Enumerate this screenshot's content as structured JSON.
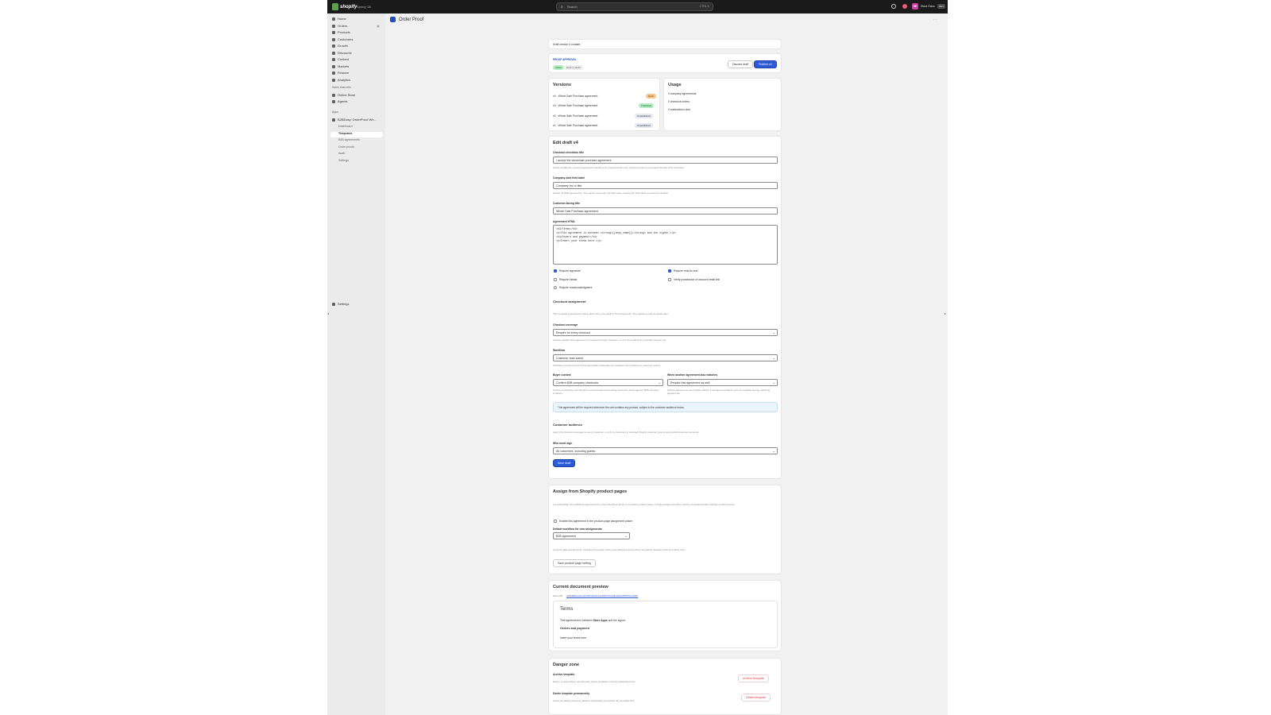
{
  "topbar": {
    "brand": "shopify",
    "store": "Spring '26",
    "search_placeholder": "Search",
    "search_shortcut": "CTRL K",
    "user_initials": "SE",
    "user_name": "Store Extra",
    "user_badge": "DEV"
  },
  "sidebar": {
    "items": [
      {
        "label": "Home"
      },
      {
        "label": "Orders",
        "badge": "3"
      },
      {
        "label": "Products"
      },
      {
        "label": "Customers"
      },
      {
        "label": "Growth"
      },
      {
        "label": "Discounts"
      },
      {
        "label": "Content"
      },
      {
        "label": "Markets"
      },
      {
        "label": "Finance"
      },
      {
        "label": "Analytics"
      }
    ],
    "sales_channels_label": "Sales channels",
    "channels": [
      {
        "label": "Online Store"
      },
      {
        "label": "Agents"
      }
    ],
    "apps_label": "Apps",
    "app_name": "B2BEasy: OrderProof Wh...",
    "app_subitems": [
      "Dashboard",
      "Templates",
      "B2B agreements",
      "Order proofs",
      "Audit",
      "Settings"
    ],
    "settings_label": "Settings"
  },
  "page": {
    "title": "Order Proof"
  },
  "banner": {
    "text": "Draft version 4 created."
  },
  "proof_header": {
    "heading": "PROOF APPROVAL",
    "status_pill": "Active",
    "draft_pill": "Draft 4 (draft)",
    "discard_label": "Discard draft",
    "publish_label": "Publish v4"
  },
  "versions": {
    "title": "Versions",
    "rows": [
      {
        "label": "v4 · Whole Sale Purchase agreement",
        "status": "Draft"
      },
      {
        "label": "v3 · Whole Sale Purchase agreement",
        "status": "Published"
      },
      {
        "label": "v2 · Whole Sale Purchase agreement",
        "status": "Unpublished"
      },
      {
        "label": "v1 · Whole Sale Purchase agreement",
        "status": "Unpublished"
      }
    ],
    "colors": {
      "Draft": "#f5c58a",
      "Published": "#b6ecc6",
      "Unpublished": "#e3e8f3"
    }
  },
  "usage": {
    "title": "Usage",
    "lines": [
      "0 company agreements",
      "0 checkout orders",
      "0 automation rules"
    ]
  },
  "edit": {
    "title": "Edit draft v4",
    "checkout_label": "Checkout checkbox title",
    "checkout_value": "I accept the wholesale purchase agreement",
    "checkout_help": "Shown beside the required agreement checkbox at checkout before the checkout action is accepted (Shopify Plus checkout).",
    "company_label": "Company-side field label",
    "company_value": "Company rep or title",
    "company_help": "Shown for B2B agreements. The signer must enter the field value, leaving the field blank removes the default.",
    "customer_label": "Customer-facing title",
    "customer_value": "Whole Sale Purchase agreement",
    "html_label": "Agreement HTML",
    "html_lines": [
      "<h3>Terms</h3>",
      "<p>This agreement is between <strong>{{shop_name}}</strong> and the signer.</p>",
      "<h4>Orders and payment</h4>",
      "<p>Insert your terms here.</p>"
    ],
    "checks": [
      {
        "label": "Require signature",
        "checked": true
      },
      {
        "label": "Require read-to-end",
        "checked": true
      },
      {
        "label": "Require initials",
        "checked": false
      },
      {
        "label": "Verify possession of account email link",
        "checked": false
      }
    ],
    "radio_label": "Require reacknowledgment",
    "assign_title": "Checkout assignment",
    "assign_help": "This template's assignment takes effect when you publish \"Proof Approval\". Also applies products added later.",
    "coverage_label": "Checkout coverage",
    "coverage_value": "Require for every checkout",
    "coverage_help": "Choose whether this agreement is required at every checkout, or only for products in a specific shopper set.",
    "workflow_label": "Workflow",
    "workflow_value": "Customer auto-saved",
    "workflow_help": "Workflow controls how the Proof and Audit credentials are created in the checkout or customer record.",
    "buyer_label": "Buyer context",
    "buyer_value": "Confirm B2B company checkouts",
    "buyer_help": "Choose a matching rule Shopify's recommended proceeding customers and logged-in B2B company locations.",
    "exists_label": "When another agreement also matches",
    "exists_value": "Require this agreement as well",
    "exists_help": "Defines agreement-use-multiple chains. It decides precedence only as it applies among matching agreements.",
    "info_text": "This agreement will be required whenever the cart contains any product, subject to the customer audience below.",
    "audience_title": "Customer audience",
    "audience_help": "Apply this checkout message to every customer, or only to customers in selected Shopify customer groups and explicit customer accounts.",
    "who_label": "Who must sign",
    "who_value": "All customers, including guests",
    "save_label": "Save draft"
  },
  "assign": {
    "title": "Assign from Shopify product pages",
    "help": "Let staff assign this published agreement from the OrderProof block on a product product page. A single assigned product must be completed before Shopify product menus.",
    "check_label": "Enable this agreement in the product page assignment picker",
    "default_label": "Default workflow for new assignments",
    "default_value": "B2B agreement",
    "note": "Controls page assignments. Checking the picker shows new assignments but does not silently reassign existing product rows.",
    "save_label": "Save product page setting"
  },
  "preview": {
    "title": "Current document preview",
    "hash_label": "SHA-256:",
    "hash_value": "2a8fa8f0beefe1a01a5f329d2ce4e59f60c1b9dbd2fa4d5f9d0bc30d8c",
    "doc_title": "Terms",
    "doc_p1_pre": "This agreement is between",
    "doc_p1_strong": "Store Apps",
    "doc_p1_post": "and the signer.",
    "doc_h4": "Orders and payment",
    "doc_p2": "Insert your terms here."
  },
  "danger": {
    "title": "Danger zone",
    "archive_label": "Archive template",
    "archive_help": "Return to legal history permanently. Active templates must be deactivated first.",
    "archive_btn": "Archive template",
    "delete_label": "Delete template permanently",
    "delete_help": "Active templates cannot be deleted. Deactivate and archive the template first.",
    "delete_btn": "Delete template"
  }
}
